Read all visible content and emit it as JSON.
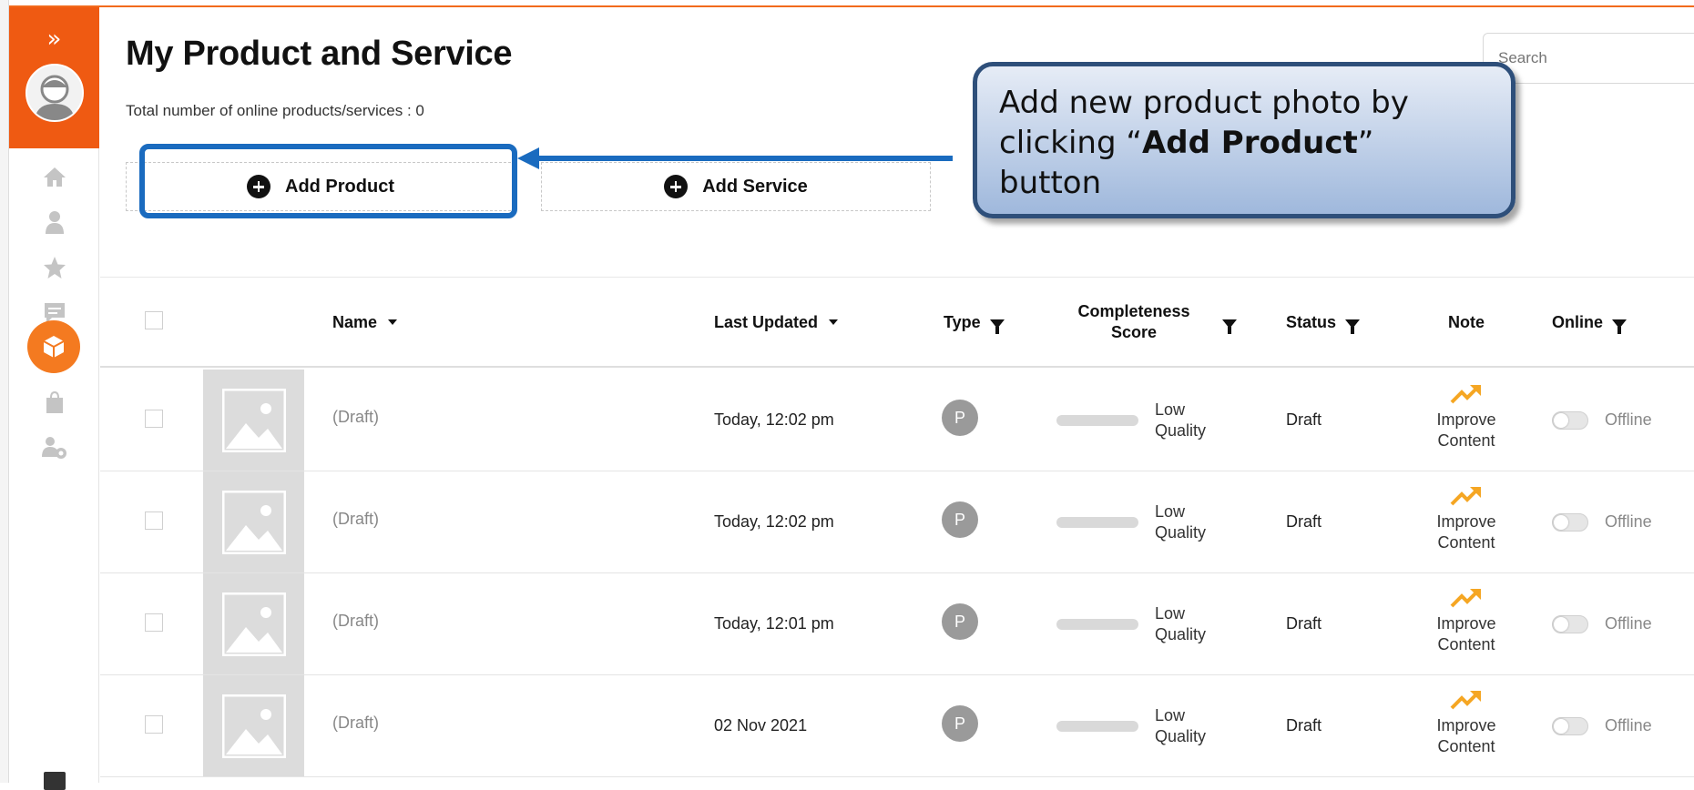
{
  "sidebar": {
    "expand_glyph": "»",
    "items": [
      {
        "icon": "home-icon"
      },
      {
        "icon": "user-icon"
      },
      {
        "icon": "star-icon"
      },
      {
        "icon": "chat-icon"
      },
      {
        "icon": "product-box-icon",
        "active": true
      },
      {
        "icon": "shopping-bag-icon"
      },
      {
        "icon": "user-settings-icon"
      }
    ]
  },
  "header": {
    "title": "My Product and Service",
    "total_line": "Total number of online products/services : 0",
    "search_placeholder": "Search"
  },
  "actions": {
    "add_product": "Add Product",
    "add_service": "Add Service"
  },
  "callout": {
    "line1": "Add new product photo by",
    "line2_pre": "clicking “",
    "line2_bold": "Add Product",
    "line2_post": "”",
    "line3": "button"
  },
  "table": {
    "columns": {
      "name": "Name",
      "last_updated": "Last Updated",
      "type": "Type",
      "completeness_line1": "Completeness",
      "completeness_line2": "Score",
      "status": "Status",
      "note": "Note",
      "online": "Online"
    },
    "rows": [
      {
        "name": "(Draft)",
        "updated": "Today, 12:02 pm",
        "type": "P",
        "quality1": "Low",
        "quality2": "Quality",
        "status": "Draft",
        "note1": "Improve",
        "note2": "Content",
        "online": "Offline"
      },
      {
        "name": "(Draft)",
        "updated": "Today, 12:02 pm",
        "type": "P",
        "quality1": "Low",
        "quality2": "Quality",
        "status": "Draft",
        "note1": "Improve",
        "note2": "Content",
        "online": "Offline"
      },
      {
        "name": "(Draft)",
        "updated": "Today, 12:01 pm",
        "type": "P",
        "quality1": "Low",
        "quality2": "Quality",
        "status": "Draft",
        "note1": "Improve",
        "note2": "Content",
        "online": "Offline"
      },
      {
        "name": "(Draft)",
        "updated": "02 Nov 2021",
        "type": "P",
        "quality1": "Low",
        "quality2": "Quality",
        "status": "Draft",
        "note1": "Improve",
        "note2": "Content",
        "online": "Offline"
      }
    ]
  },
  "colors": {
    "brand_orange": "#ef5a12",
    "highlight_blue": "#1a6bbf",
    "trend_icon": "#f5a623"
  }
}
